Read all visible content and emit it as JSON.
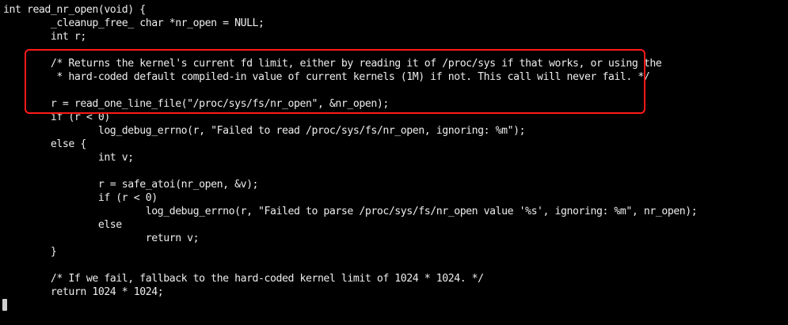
{
  "editor": {
    "lines": [
      "int read_nr_open(void) {",
      "        _cleanup_free_ char *nr_open = NULL;",
      "        int r;",
      "",
      "        /* Returns the kernel's current fd limit, either by reading it of /proc/sys if that works, or using the",
      "         * hard-coded default compiled-in value of current kernels (1M) if not. This call will never fail. */",
      "",
      "        r = read_one_line_file(\"/proc/sys/fs/nr_open\", &nr_open);",
      "        if (r < 0)",
      "                log_debug_errno(r, \"Failed to read /proc/sys/fs/nr_open, ignoring: %m\");",
      "        else {",
      "                int v;",
      "",
      "                r = safe_atoi(nr_open, &v);",
      "                if (r < 0)",
      "                        log_debug_errno(r, \"Failed to parse /proc/sys/fs/nr_open value '%s', ignoring: %m\", nr_open);",
      "                else",
      "                        return v;",
      "        }",
      "",
      "        /* If we fail, fallback to the hard-coded kernel limit of 1024 * 1024. */",
      "        return 1024 * 1024;"
    ]
  },
  "colors": {
    "background": "#000000",
    "text": "#ededed",
    "highlight_border": "#ff1a1a",
    "cursor": "#cfcfcf"
  }
}
